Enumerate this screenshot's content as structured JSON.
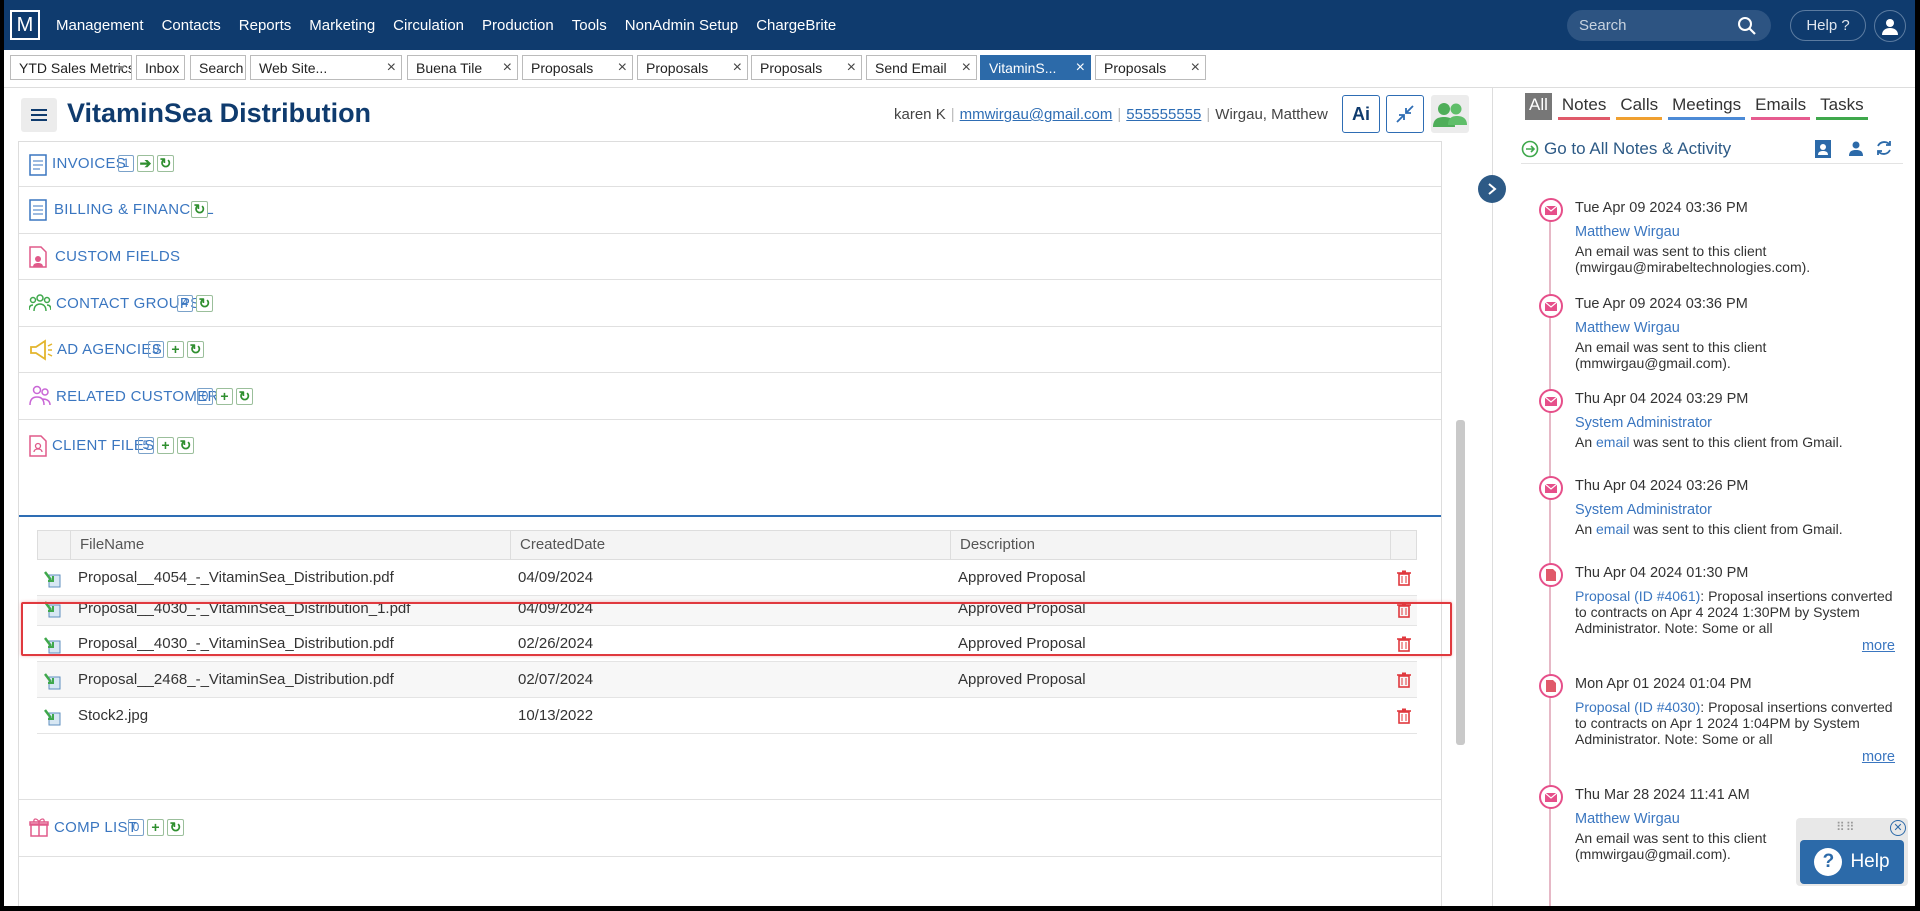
{
  "nav": {
    "logo": "M",
    "items": [
      "Management",
      "Contacts",
      "Reports",
      "Marketing",
      "Circulation",
      "Production",
      "Tools",
      "NonAdmin Setup",
      "ChargeBrite"
    ],
    "search_placeholder": "Search",
    "help_label": "Help ?"
  },
  "tabs": [
    {
      "label": "YTD Sales Metrics",
      "closable": false,
      "dropdown": true
    },
    {
      "label": "Inbox",
      "closable": false
    },
    {
      "label": "Search",
      "closable": false
    },
    {
      "label": "Web Site...",
      "closable": true
    },
    {
      "label": "Buena Tile",
      "closable": true
    },
    {
      "label": "Proposals",
      "closable": true
    },
    {
      "label": "Proposals",
      "closable": true
    },
    {
      "label": "Proposals",
      "closable": true
    },
    {
      "label": "Send Email",
      "closable": true
    },
    {
      "label": "VitaminS...",
      "closable": true,
      "active": true
    },
    {
      "label": "Proposals",
      "closable": true
    }
  ],
  "header": {
    "client_name": "VitaminSea Distribution",
    "contact_name": "karen K",
    "email": "mmwirgau@gmail.com",
    "phone": "555555555",
    "rep": "Wirgau, Matthew",
    "ai_label": "Ai"
  },
  "sections": {
    "invoices": {
      "title": "INVOICES",
      "count": "1"
    },
    "billing": {
      "title": "BILLING & FINANCIAL"
    },
    "custom_fields": {
      "title": "CUSTOM FIELDS"
    },
    "contact_groups": {
      "title": "CONTACT GROUPS",
      "count": "4"
    },
    "ad_agencies": {
      "title": "AD AGENCIES",
      "count": "0"
    },
    "related_customers": {
      "title": "RELATED CUSTOMERS",
      "count": "0"
    },
    "client_files": {
      "title": "CLIENT FILES",
      "count": "5"
    },
    "comp_list": {
      "title": "COMP LIST",
      "count": "0"
    }
  },
  "files_table": {
    "columns": [
      "FileName",
      "CreatedDate",
      "Description"
    ],
    "rows": [
      {
        "name": "Proposal__4054_-_VitaminSea_Distribution.pdf",
        "date": "04/09/2024",
        "desc": "Approved Proposal"
      },
      {
        "name": "Proposal__4030_-_VitaminSea_Distribution_1.pdf",
        "date": "04/09/2024",
        "desc": "Approved Proposal"
      },
      {
        "name": "Proposal__4030_-_VitaminSea_Distribution.pdf",
        "date": "02/26/2024",
        "desc": "Approved Proposal"
      },
      {
        "name": "Proposal__2468_-_VitaminSea_Distribution.pdf",
        "date": "02/07/2024",
        "desc": "Approved Proposal"
      },
      {
        "name": "Stock2.jpg",
        "date": "10/13/2022",
        "desc": ""
      }
    ]
  },
  "activity": {
    "filters": [
      "All",
      "Notes",
      "Calls",
      "Meetings",
      "Emails",
      "Tasks"
    ],
    "goto_label": "Go to All Notes & Activity",
    "items": [
      {
        "type": "email",
        "date": "Tue Apr 09 2024 03:36 PM",
        "who": "Matthew Wirgau",
        "text": "An email was sent to this client (mwirgau@mirabeltechnologies.com)."
      },
      {
        "type": "email",
        "date": "Tue Apr 09 2024 03:36 PM",
        "who": "Matthew Wirgau",
        "text": "An email was sent to this client (mmwirgau@gmail.com)."
      },
      {
        "type": "email",
        "date": "Thu Apr 04 2024 03:29 PM",
        "who": "System Administrator",
        "text_pre": "An ",
        "text_link": "email",
        "text_post": " was sent to this client from Gmail."
      },
      {
        "type": "email",
        "date": "Thu Apr 04 2024 03:26 PM",
        "who": "System Administrator",
        "text_pre": "An ",
        "text_link": "email",
        "text_post": " was sent to this client from Gmail."
      },
      {
        "type": "proposal",
        "date": "Thu Apr 04 2024 01:30 PM",
        "link": "Proposal (ID #4061)",
        "text": ": Proposal insertions converted to contracts on Apr 4 2024 1:30PM by System Administrator. Note: Some or all",
        "more": "more"
      },
      {
        "type": "proposal",
        "date": "Mon Apr 01 2024 01:04 PM",
        "link": "Proposal (ID #4030)",
        "text": ": Proposal insertions converted to contracts on Apr 1 2024 1:04PM by System Administrator. Note: Some or all",
        "more": "more"
      },
      {
        "type": "email",
        "date": "Thu Mar 28 2024 11:41 AM",
        "who": "Matthew Wirgau",
        "text": "An email was sent to this client (mmwirgau@gmail.com)."
      }
    ]
  },
  "help_widget": {
    "label": "Help",
    "q": "?"
  },
  "colors": {
    "nav": "#0f3b6e",
    "accent": "#3a76c0",
    "highlight": "#e0393e"
  }
}
